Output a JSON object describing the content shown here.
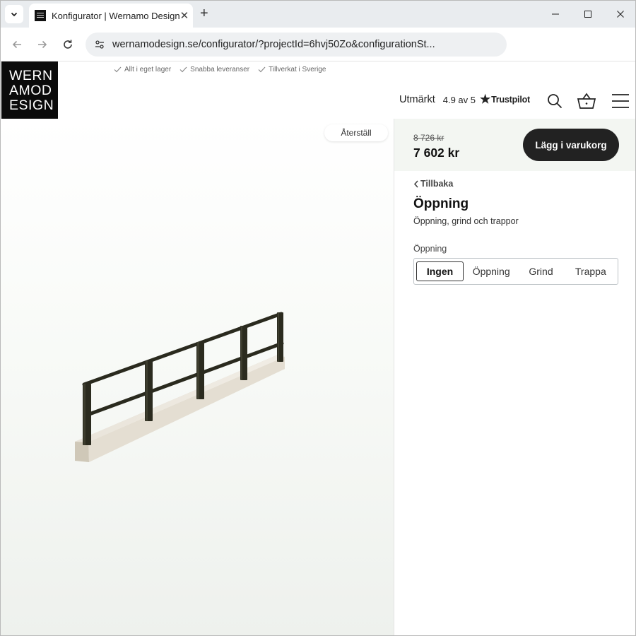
{
  "browser": {
    "tab_title": "Konfigurator | Wernamo Design",
    "tab_close": "✕",
    "new_tab": "+",
    "url": "wernamodesign.se/configurator/?projectId=6hvj50Zo&configurationSt..."
  },
  "header": {
    "logo_lines": [
      "WERN",
      "AMOD",
      "ESIGN"
    ],
    "usps": [
      "Allt i eget lager",
      "Snabba leveranser",
      "Tillverkat i Sverige"
    ],
    "rating_word": "Utmärkt",
    "rating_score": "4.9 av 5",
    "rating_brand": "Trustpilot",
    "icons": [
      "search-icon",
      "basket-icon",
      "menu-icon"
    ]
  },
  "viewer": {
    "reset_label": "Återställ"
  },
  "panel": {
    "old_price": "8 726 kr",
    "price": "7 602 kr",
    "cart_button": "Lägg i varukorg",
    "back_label": "Tillbaka",
    "title": "Öppning",
    "subtitle": "Öppning, grind och trappor",
    "option_label": "Öppning",
    "options": [
      "Ingen",
      "Öppning",
      "Grind",
      "Trappa"
    ],
    "selected_option": "Ingen"
  },
  "colors": {
    "logo_bg": "#0b0b0b",
    "cart_button_bg": "#222222",
    "price_bar_bg": "#f3f6f2",
    "railing": "#2a2a1e",
    "base": "#e6e1d6"
  }
}
